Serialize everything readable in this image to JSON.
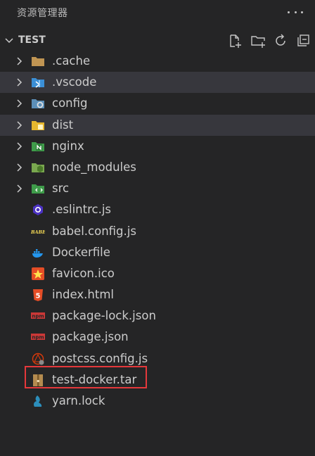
{
  "header": {
    "title": "资源管理器",
    "more_icon": "more-icon"
  },
  "section": {
    "title": "TEST",
    "actions": [
      "new-file-icon",
      "new-folder-icon",
      "refresh-icon",
      "collapse-all-icon"
    ]
  },
  "tree": [
    {
      "label": ".cache",
      "type": "folder",
      "icon": "folder-icon"
    },
    {
      "label": ".vscode",
      "type": "folder",
      "icon": "vscode-folder-icon",
      "selected": true
    },
    {
      "label": "config",
      "type": "folder",
      "icon": "config-folder-icon"
    },
    {
      "label": "dist",
      "type": "folder",
      "icon": "dist-folder-icon",
      "selected": true
    },
    {
      "label": "nginx",
      "type": "folder",
      "icon": "nginx-folder-icon"
    },
    {
      "label": "node_modules",
      "type": "folder",
      "icon": "node-folder-icon"
    },
    {
      "label": "src",
      "type": "folder",
      "icon": "src-folder-icon"
    },
    {
      "label": ".eslintrc.js",
      "type": "file",
      "icon": "eslint-icon"
    },
    {
      "label": "babel.config.js",
      "type": "file",
      "icon": "babel-icon",
      "icon_text": "BABEL"
    },
    {
      "label": "Dockerfile",
      "type": "file",
      "icon": "docker-icon"
    },
    {
      "label": "favicon.ico",
      "type": "file",
      "icon": "star-icon"
    },
    {
      "label": "index.html",
      "type": "file",
      "icon": "html5-icon",
      "icon_text": "5"
    },
    {
      "label": "package-lock.json",
      "type": "file",
      "icon": "npm-icon",
      "icon_text": "npm"
    },
    {
      "label": "package.json",
      "type": "file",
      "icon": "npm-icon",
      "icon_text": "npm"
    },
    {
      "label": "postcss.config.js",
      "type": "file",
      "icon": "postcss-icon"
    },
    {
      "label": "test-docker.tar",
      "type": "file",
      "icon": "archive-icon",
      "highlighted": true
    },
    {
      "label": "yarn.lock",
      "type": "file",
      "icon": "yarn-icon"
    }
  ],
  "colors": {
    "background": "#252526",
    "selected": "#37373d",
    "highlight_border": "#e5383b",
    "text": "#cccccc"
  }
}
